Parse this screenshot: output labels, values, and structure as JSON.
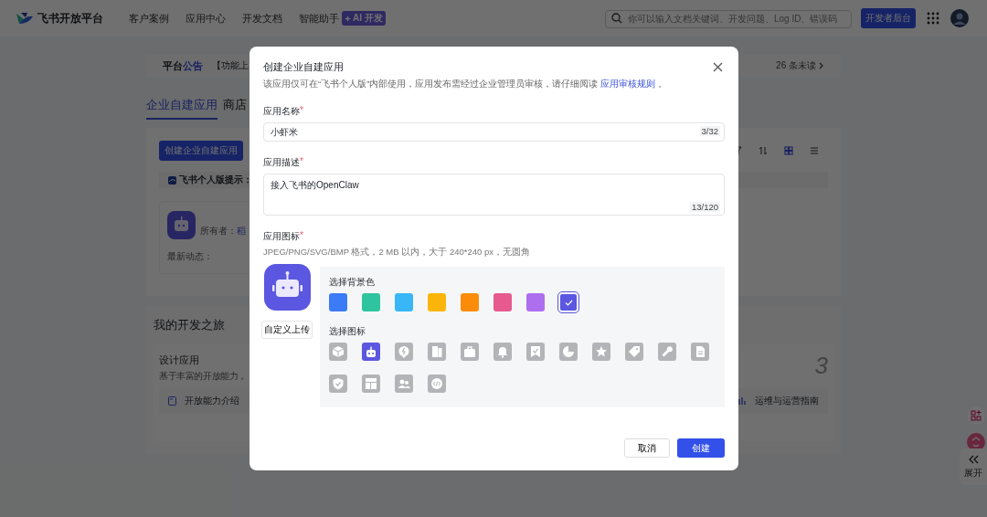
{
  "header": {
    "brand": "飞书开放平台",
    "nav": [
      {
        "label": "客户案例"
      },
      {
        "label": "应用中心"
      },
      {
        "label": "开发文档"
      },
      {
        "label": "智能助手",
        "badge": "AI 开发"
      }
    ],
    "search": {
      "placeholder": "你可以输入文档关键词、开发问题、Log ID、错误码"
    },
    "console_button": "开发者后台"
  },
  "announcement": {
    "title_lead": "平台",
    "title_accent": "公告",
    "text": "【功能上",
    "unread": "26 条未读"
  },
  "tabs": [
    {
      "label": "企业自建应用",
      "selected": true
    },
    {
      "label": "商店",
      "selected": false
    }
  ],
  "apps_panel": {
    "create_button": "创建企业自建应用",
    "view_modes": [
      {
        "kind": "grid",
        "selected": true
      },
      {
        "kind": "list",
        "selected": false
      }
    ],
    "tip_label": "飞书个人版提示：",
    "app_card": {
      "owner_label": "所有者：",
      "owner": "稻",
      "activity_label": "最新动态："
    }
  },
  "journey": {
    "title": "我的开发之旅",
    "card": {
      "title": "设计应用",
      "text": "基于丰富的开放能力，",
      "link": "开放能力介绍"
    },
    "step_number": "3",
    "guide_link": "运维与运营指南"
  },
  "float_panel": {
    "expand": "展开"
  },
  "dialog": {
    "title": "创建企业自建应用",
    "notice": "该应用仅可在“飞书个人版”内部使用，应用发布需经过企业管理员审核，请仔细阅读",
    "notice_link": "应用审核规则",
    "notice_end": "。",
    "name_field": {
      "label": "应用名称",
      "mark": "*",
      "value": "小虾米",
      "count": "3/32"
    },
    "desc_field": {
      "label": "应用描述",
      "mark": "*",
      "value": "接入飞书的OpenClaw",
      "count": "13/120"
    },
    "icon_field": {
      "label": "应用图标",
      "mark": "*",
      "hint": "JPEG/PNG/SVG/BMP 格式，2 MB 以内，大于 240*240 px，无圆角",
      "upload_button": "自定义上传",
      "color_label": "选择背景色",
      "colors": [
        {
          "color": "#3b7bf6",
          "selected": false
        },
        {
          "color": "#2ec4a0",
          "selected": false
        },
        {
          "color": "#38b6f6",
          "selected": false
        },
        {
          "color": "#fbb50a",
          "selected": false
        },
        {
          "color": "#fb8c0a",
          "selected": false
        },
        {
          "color": "#e65a8f",
          "selected": false
        },
        {
          "color": "#ad6ef0",
          "selected": false
        },
        {
          "color": "#5b57e0",
          "selected": true
        }
      ],
      "icon_label": "选择图标",
      "icons": [
        {
          "kind": "cube",
          "selected": false
        },
        {
          "kind": "robot",
          "selected": true
        },
        {
          "kind": "bolt",
          "selected": false
        },
        {
          "kind": "panels",
          "selected": false
        },
        {
          "kind": "briefcase",
          "selected": false
        },
        {
          "kind": "bell",
          "selected": false
        },
        {
          "kind": "bookmark",
          "selected": false
        },
        {
          "kind": "pie",
          "selected": false
        },
        {
          "kind": "star",
          "selected": false
        },
        {
          "kind": "tag",
          "selected": false
        },
        {
          "kind": "wrench",
          "selected": false
        },
        {
          "kind": "file",
          "selected": false
        },
        {
          "kind": "shield",
          "selected": false
        },
        {
          "kind": "layout",
          "selected": false
        },
        {
          "kind": "people",
          "selected": false
        },
        {
          "kind": "code",
          "selected": false
        }
      ]
    },
    "buttons": {
      "cancel": "取消",
      "create": "创建"
    }
  }
}
